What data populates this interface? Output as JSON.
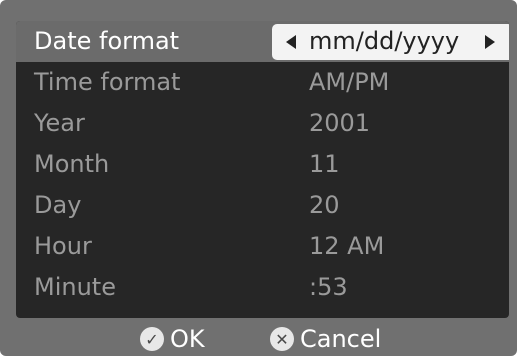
{
  "settings": {
    "rows": [
      {
        "label": "Date format",
        "value": "mm/dd/yyyy"
      },
      {
        "label": "Time format",
        "value": "AM/PM"
      },
      {
        "label": "Year",
        "value": "2001"
      },
      {
        "label": "Month",
        "value": "11"
      },
      {
        "label": "Day",
        "value": "20"
      },
      {
        "label": "Hour",
        "value": "12 AM"
      },
      {
        "label": "Minute",
        "value": ":53"
      }
    ],
    "selected_index": 0
  },
  "footer": {
    "ok_label": "OK",
    "ok_icon": "check-icon",
    "cancel_label": "Cancel",
    "cancel_icon": "x-icon"
  },
  "colors": {
    "background": "#707070",
    "panel": "#262626",
    "selected_row": "#6b6b6b",
    "value_box": "#f3f3f3",
    "muted_text": "#9a9a9a"
  }
}
